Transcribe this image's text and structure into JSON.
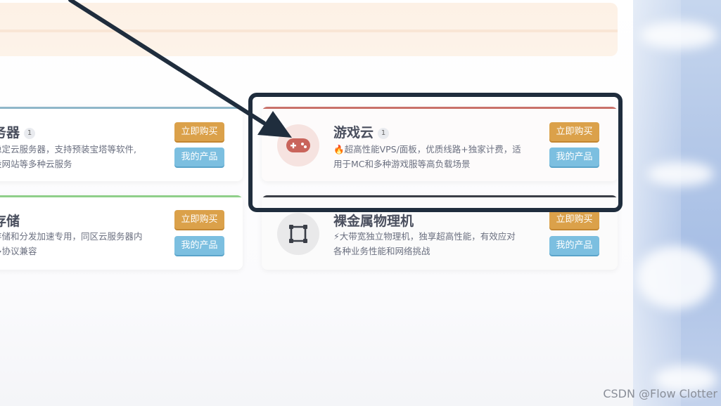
{
  "cards": [
    {
      "title": "务器",
      "count": "1",
      "desc_line1": "稳定云服务器，支持预装宝塔等软件,",
      "desc_line2": "设网站等多种云服务",
      "buy_label": "立即购买",
      "mine_label": "我的产品",
      "accent": "#8fb7c9"
    },
    {
      "title": "存储",
      "desc_line1": "存储和分发加速专用，同区云服务器内",
      "desc_line2": "多协议兼容",
      "buy_label": "立即购买",
      "mine_label": "我的产品",
      "accent": "#8fcf8a"
    },
    {
      "title": "游戏云",
      "count": "1",
      "desc_line1": "🔥超高性能VPS/面板，优质线路+独家计费，适",
      "desc_line2": "用于MC和多种游戏服等高负载场景",
      "buy_label": "立即购买",
      "mine_label": "我的产品",
      "icon": "gamepad-icon",
      "accent": "#c9726a"
    },
    {
      "title": "裸金属物理机",
      "desc_line1": "⚡大带宽独立物理机，独享超高性能，有效应对",
      "desc_line2": "各种业务性能和网络挑战",
      "buy_label": "立即购买",
      "mine_label": "我的产品",
      "icon": "server-frame-icon",
      "accent": "#3a3e47"
    }
  ],
  "annotation": {
    "arrow_color": "#1f2d3d",
    "box_color": "#1f2d3d"
  },
  "watermark": "CSDN @Flow Clotter"
}
